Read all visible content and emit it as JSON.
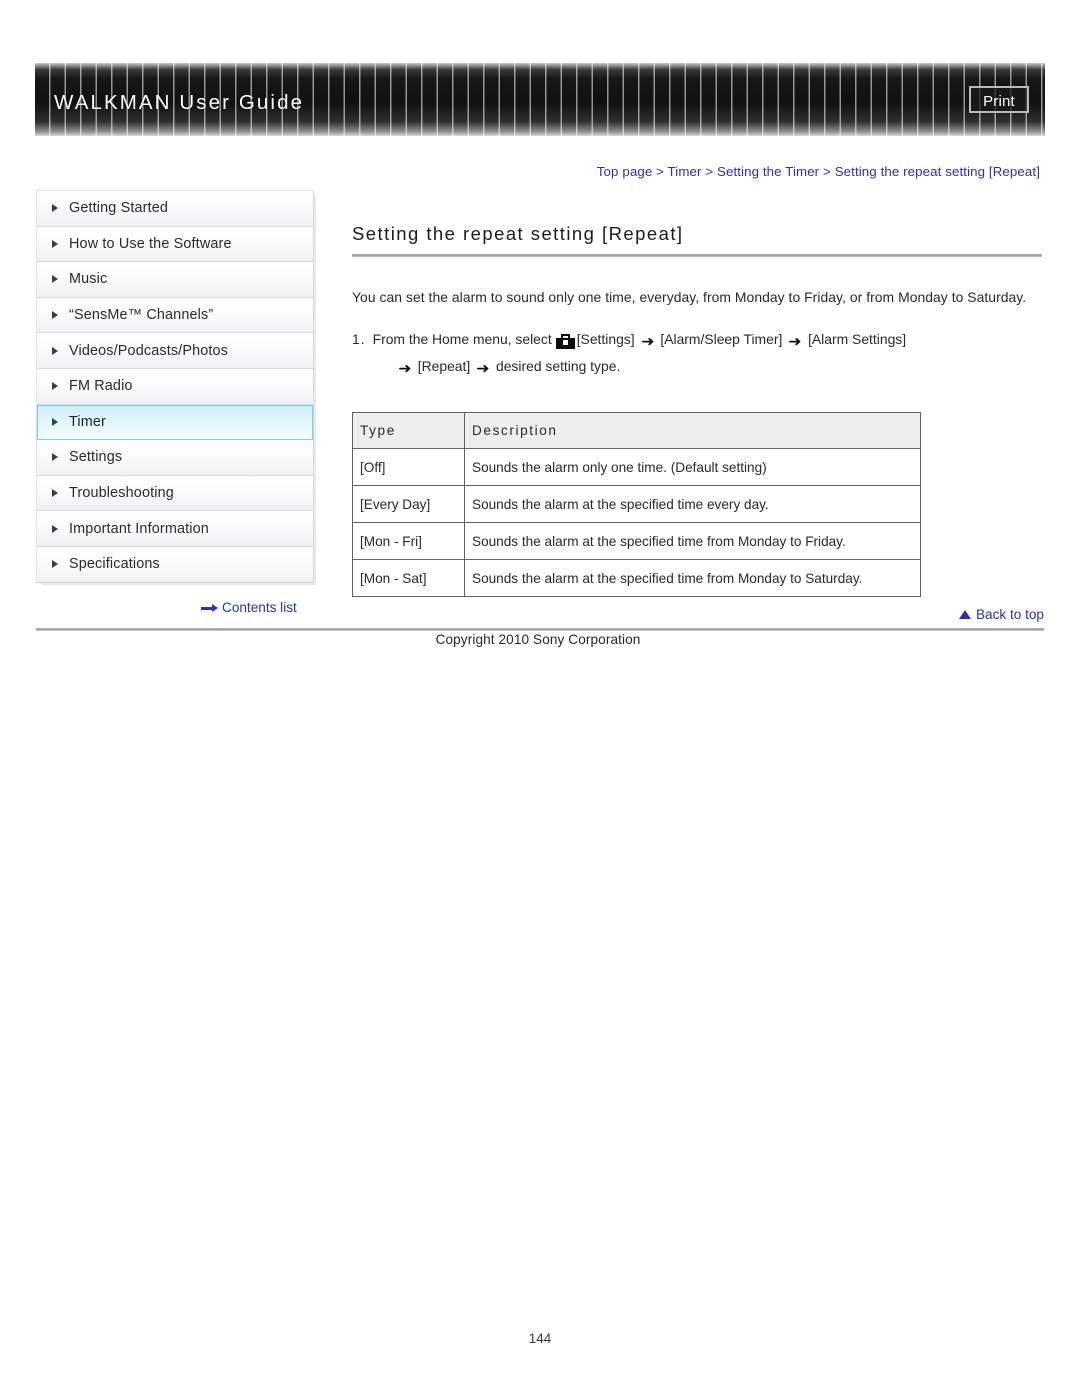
{
  "header": {
    "title": "WALKMAN User Guide",
    "print_label": "Print"
  },
  "breadcrumb": {
    "items": [
      "Top page",
      "Timer",
      "Setting the Timer",
      "Setting the repeat setting [Repeat]"
    ],
    "separator": ">",
    "full_text": "Top page > Timer > Setting the Timer > Setting the repeat setting [Repeat]"
  },
  "sidebar": {
    "items": [
      {
        "label": "Getting Started",
        "active": false
      },
      {
        "label": "How to Use the Software",
        "active": false
      },
      {
        "label": "Music",
        "active": false
      },
      {
        "label": "“SensMe™ Channels”",
        "active": false
      },
      {
        "label": "Videos/Podcasts/Photos",
        "active": false
      },
      {
        "label": "FM Radio",
        "active": false
      },
      {
        "label": "Timer",
        "active": true
      },
      {
        "label": "Settings",
        "active": false
      },
      {
        "label": "Troubleshooting",
        "active": false
      },
      {
        "label": "Important Information",
        "active": false
      },
      {
        "label": "Specifications",
        "active": false
      }
    ]
  },
  "main": {
    "title": "Setting the repeat setting [Repeat]",
    "intro": "You can set the alarm to sound only one time, everyday, from Monday to Friday, or from Monday to Saturday.",
    "step": {
      "number": "1.",
      "line1_before_icon": "From the Home menu, select",
      "after_icon": "[Settings]",
      "arrow": "➜",
      "part2": "[Alarm/Sleep Timer]",
      "part3": "[Alarm Settings]",
      "line2_part1": "[Repeat]",
      "line2_part2": "desired setting type."
    },
    "table": {
      "headers": [
        "Type",
        "Description"
      ],
      "rows": [
        [
          "[Off]",
          "Sounds the alarm only one time. (Default setting)"
        ],
        [
          "[Every Day]",
          "Sounds the alarm at the specified time every day."
        ],
        [
          "[Mon - Fri]",
          "Sounds the alarm at the specified time from Monday to Friday."
        ],
        [
          "[Mon - Sat]",
          "Sounds the alarm at the specified time from Monday to Saturday."
        ]
      ]
    }
  },
  "footer": {
    "contents_link": "Contents list",
    "back_to_top": "Back to top",
    "copyright": "Copyright 2010 Sony Corporation",
    "page_number": "144"
  },
  "colors": {
    "link_blue": "#2b30b6",
    "active_nav": "#cdeef7",
    "table_header_bg": "#eeeeee"
  }
}
